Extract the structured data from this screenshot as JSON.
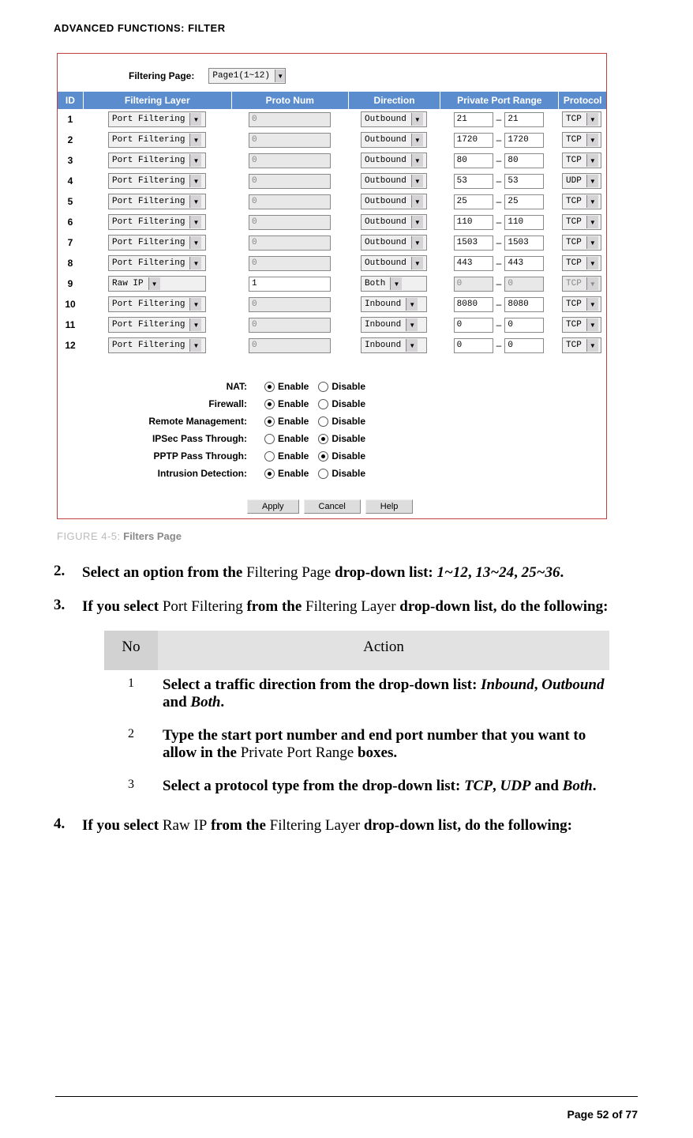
{
  "header": {
    "title": "ADVANCED FUNCTIONS: FILTER"
  },
  "figure": {
    "filtering_page_label": "Filtering Page:",
    "filtering_page_value": "Page1(1~12)",
    "columns": {
      "id": "ID",
      "layer": "Filtering Layer",
      "proto_num": "Proto Num",
      "direction": "Direction",
      "range": "Private Port Range",
      "protocol": "Protocol"
    },
    "rows": [
      {
        "id": "1",
        "layer": "Port Filtering",
        "proto": "0",
        "dir": "Outbound",
        "p1": "21",
        "p2": "21",
        "pr": "TCP",
        "raw": false
      },
      {
        "id": "2",
        "layer": "Port Filtering",
        "proto": "0",
        "dir": "Outbound",
        "p1": "1720",
        "p2": "1720",
        "pr": "TCP",
        "raw": false
      },
      {
        "id": "3",
        "layer": "Port Filtering",
        "proto": "0",
        "dir": "Outbound",
        "p1": "80",
        "p2": "80",
        "pr": "TCP",
        "raw": false
      },
      {
        "id": "4",
        "layer": "Port Filtering",
        "proto": "0",
        "dir": "Outbound",
        "p1": "53",
        "p2": "53",
        "pr": "UDP",
        "raw": false
      },
      {
        "id": "5",
        "layer": "Port Filtering",
        "proto": "0",
        "dir": "Outbound",
        "p1": "25",
        "p2": "25",
        "pr": "TCP",
        "raw": false
      },
      {
        "id": "6",
        "layer": "Port Filtering",
        "proto": "0",
        "dir": "Outbound",
        "p1": "110",
        "p2": "110",
        "pr": "TCP",
        "raw": false
      },
      {
        "id": "7",
        "layer": "Port Filtering",
        "proto": "0",
        "dir": "Outbound",
        "p1": "1503",
        "p2": "1503",
        "pr": "TCP",
        "raw": false
      },
      {
        "id": "8",
        "layer": "Port Filtering",
        "proto": "0",
        "dir": "Outbound",
        "p1": "443",
        "p2": "443",
        "pr": "TCP",
        "raw": false
      },
      {
        "id": "9",
        "layer": "Raw IP",
        "proto": "1",
        "dir": "Both",
        "p1": "0",
        "p2": "0",
        "pr": "TCP",
        "raw": true
      },
      {
        "id": "10",
        "layer": "Port Filtering",
        "proto": "0",
        "dir": "Inbound",
        "p1": "8080",
        "p2": "8080",
        "pr": "TCP",
        "raw": false
      },
      {
        "id": "11",
        "layer": "Port Filtering",
        "proto": "0",
        "dir": "Inbound",
        "p1": "0",
        "p2": "0",
        "pr": "TCP",
        "raw": false
      },
      {
        "id": "12",
        "layer": "Port Filtering",
        "proto": "0",
        "dir": "Inbound",
        "p1": "0",
        "p2": "0",
        "pr": "TCP",
        "raw": false
      }
    ],
    "options": [
      {
        "label": "NAT:",
        "enable": true
      },
      {
        "label": "Firewall:",
        "enable": true
      },
      {
        "label": "Remote Management:",
        "enable": true
      },
      {
        "label": "IPSec Pass Through:",
        "enable": false
      },
      {
        "label": "PPTP Pass Through:",
        "enable": false
      },
      {
        "label": "Intrusion Detection:",
        "enable": true
      }
    ],
    "opt_enable": "Enable",
    "opt_disable": "Disable",
    "btn_apply": "Apply",
    "btn_cancel": "Cancel",
    "btn_help": "Help"
  },
  "caption": {
    "prefix": "FIGURE 4-5:",
    "title": "Filters Page"
  },
  "steps": {
    "s2_no": "2.",
    "s2_a": "Select an option from the ",
    "s2_b": "Filtering Page",
    "s2_c": " drop-down list: ",
    "s2_d": "1~12",
    "s2_e": ", ",
    "s2_f": "13~24",
    "s2_g": ", ",
    "s2_h": "25~36",
    "s2_i": ".",
    "s3_no": "3.",
    "s3_a": "If you select ",
    "s3_b": "Port Filtering",
    "s3_c": " from the ",
    "s3_d": "Filtering Layer",
    "s3_e": " drop-down list, do the following:",
    "s4_no": "4.",
    "s4_a": "If you select ",
    "s4_b": "Raw IP",
    "s4_c": " from the ",
    "s4_d": "Filtering Layer",
    "s4_e": " drop-down list, do the following:"
  },
  "action_table": {
    "h_no": "No",
    "h_action": "Action",
    "r1_no": "1",
    "r1_a": "Select a traffic direction from the drop-down list: ",
    "r1_b": "Inbound",
    "r1_c": ", ",
    "r1_d": "Outbound",
    "r1_e": " and ",
    "r1_f": "Both",
    "r1_g": ".",
    "r2_no": "2",
    "r2_a": "Type the start port number and end port number that you want to allow in the ",
    "r2_b": "Private Port Range",
    "r2_c": " boxes.",
    "r3_no": "3",
    "r3_a": "Select a protocol type from the drop-down list: ",
    "r3_b": "TCP",
    "r3_c": ", ",
    "r3_d": "UDP",
    "r3_e": " and ",
    "r3_f": "Both",
    "r3_g": "."
  },
  "footer": {
    "page": "Page 52 of 77"
  }
}
